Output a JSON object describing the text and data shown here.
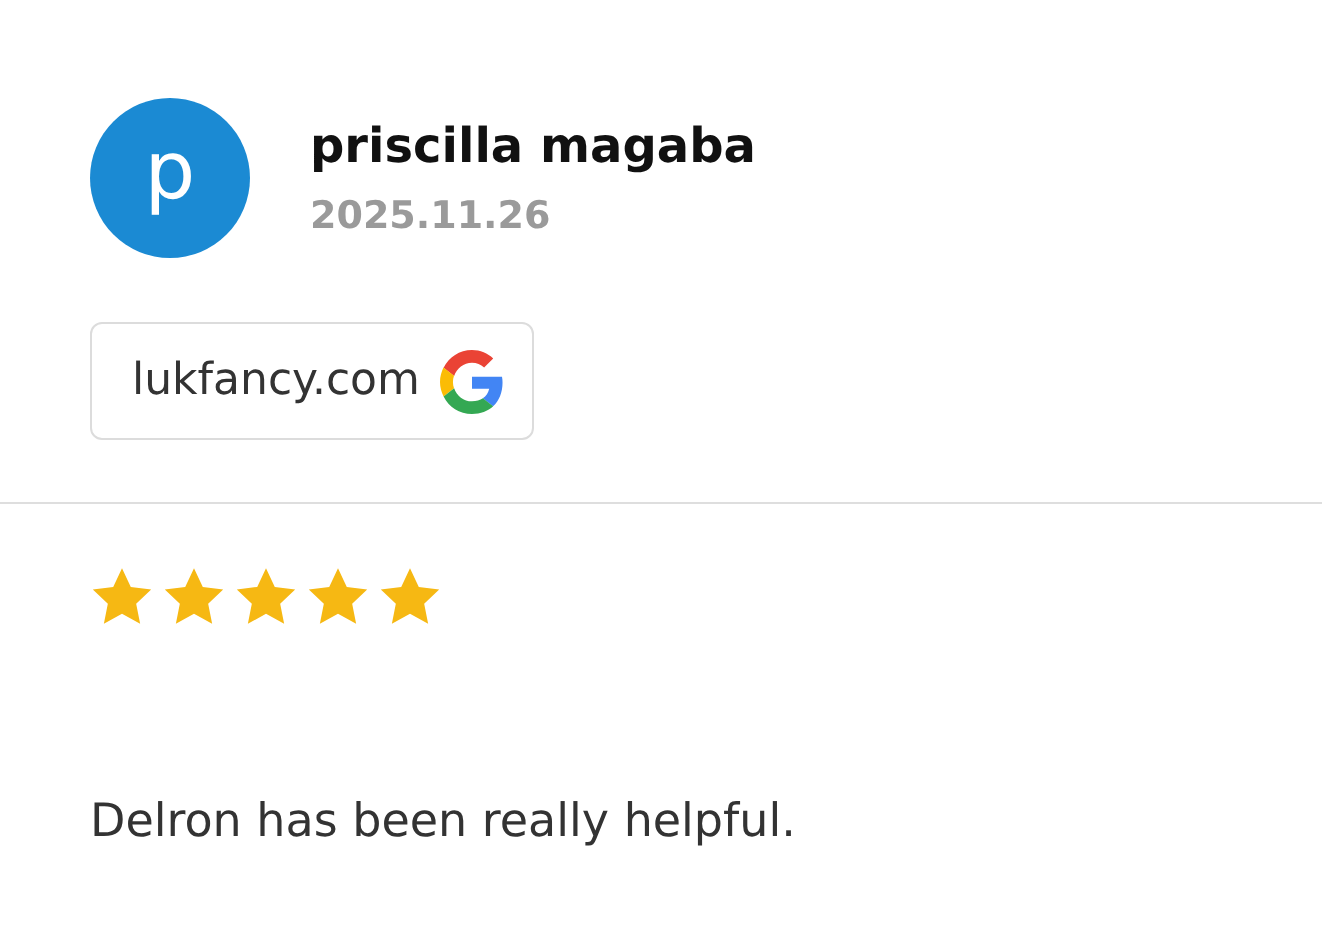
{
  "review": {
    "avatar_letter": "p",
    "author": "priscilla magaba",
    "date": "2025.11.26",
    "source": "lukfancy.com",
    "stars": 5,
    "text": "Delron has been really helpful."
  }
}
